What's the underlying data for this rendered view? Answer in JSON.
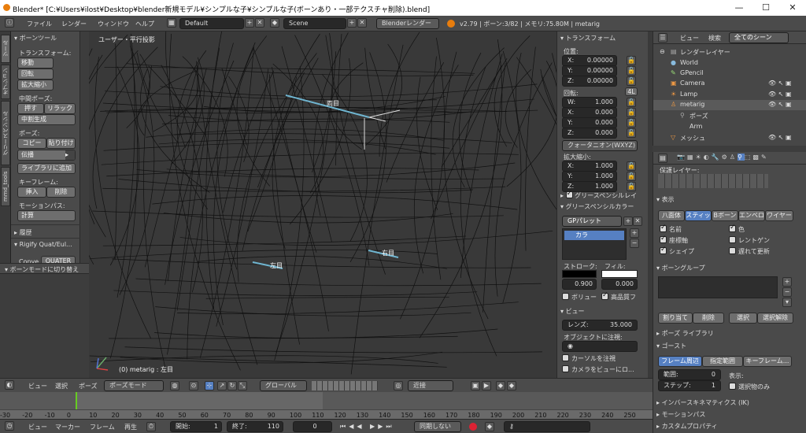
{
  "titlebar": {
    "title": "Blender* [C:¥Users¥ilost¥Desktop¥blender新規モデル¥シンプルな子¥シンプルな子(ボーンあり・一部テクスチャ削除).blend]",
    "min": "—",
    "max": "☐",
    "close": "✕"
  },
  "menu": {
    "file": "ファイル",
    "render": "レンダー",
    "window": "ウィンドウ",
    "help": "ヘルプ",
    "layout": "Default",
    "scene": "Scene",
    "engine": "Blenderレンダー",
    "status": "v2.79 | ボーン:3/82 | メモリ:75.80M | metarig"
  },
  "toolshelf": {
    "panel": "ボーンツール",
    "transform": "トランスフォーム:",
    "move": "移動",
    "rotate": "回転",
    "scale": "拡大縮小",
    "mid_pose": "中間ポーズ:",
    "push": "押す",
    "relax": "リラック",
    "breakdown": "中割生成",
    "pose": "ポーズ:",
    "copy": "コピー",
    "paste": "貼り付け",
    "propagate": "伝播",
    "add_library": "ライブラリに追加",
    "keyframes": "キーフレーム:",
    "insert": "挿入",
    "delete": "削除",
    "motion_paths": "モーションパス:",
    "calculate": "計算",
    "history": "履歴",
    "rigify": "Rigify Quat/Eul...",
    "convert": "Conve",
    "quater": "QUATER",
    "toggle": "ボーンモードに切り替え",
    "tabs": [
      "ツール",
      "オプション",
      "グリースペンシル",
      "mmd_tools"
    ]
  },
  "viewport": {
    "view_label": "ユーザー・平行投影",
    "bone_both": "両目",
    "bone_left": "左目",
    "bone_right": "右目",
    "status": "(0) metarig : 左目"
  },
  "npanel": {
    "transform": "トランスフォーム",
    "location": "位置:",
    "x": "X:",
    "y": "Y:",
    "z": "Z:",
    "w": "W:",
    "loc_x": "0.00000",
    "loc_y": "0.00000",
    "loc_z": "0.00000",
    "rotation": "回転:",
    "mode_4l": "4L",
    "rot_w": "1.000",
    "rot_x": "0.000",
    "rot_y": "0.000",
    "rot_z": "0.000",
    "quat": "クォータニオン(WXYZ)",
    "scale": "拡大縮小:",
    "scl_x": "1.000",
    "scl_y": "1.000",
    "scl_z": "1.000",
    "gp_layer": "グリースペンシルレイ",
    "gp_color": "グリースペンシルカラー",
    "gp_palette": "GPパレット",
    "color": "カラ",
    "stroke": "ストローク:",
    "fill": "フィル:",
    "stroke_val": "0.900",
    "fill_val": "0.000",
    "volume": "ボリュー",
    "hq": "高品質フ",
    "view": "ビュー",
    "lens": "レンズ:",
    "lens_val": "35.000",
    "lock_obj": "オブジェクトに注視:",
    "lock_cursor": "カーソルを注視",
    "lock_camera": "カメラをビューにロ..."
  },
  "outliner": {
    "view": "ビュー",
    "search": "検索",
    "scene_sel": "全てのシーン",
    "items": [
      "レンダーレイヤー",
      "World",
      "GPencil",
      "Camera",
      "Lamp",
      "metarig",
      "ポーズ",
      "Arm",
      "メッシュ"
    ]
  },
  "properties": {
    "protect": "保護レイヤー:",
    "display": "表示",
    "d_tabs": [
      "八面体",
      "スティッ",
      "Bボーン",
      "エンベロ",
      "ワイヤー"
    ],
    "name": "名前",
    "color": "色",
    "axes": "座標軸",
    "xray": "レントゲン",
    "shape": "シェイプ",
    "delay": "遅れて更新",
    "bone_groups": "ボーングループ",
    "assign": "割り当て",
    "remove": "削除",
    "select": "選択",
    "deselect": "選択解除",
    "pose_library": "ポーズ ライブラリ",
    "ghost": "ゴースト",
    "g_tabs": [
      "フレーム周辺",
      "指定範囲",
      "キーフレーム..."
    ],
    "range": "範囲:",
    "range_val": "0",
    "step": "ステップ:",
    "step_val": "1",
    "display2": "表示:",
    "sel_only": "選択物のみ",
    "ik": "インバースキネマティクス (IK)",
    "motion_paths": "モーションパス",
    "custom_props": "カスタムプロパティ"
  },
  "vpheader": {
    "view": "ビュー",
    "select": "選択",
    "pose": "ポーズ",
    "mode": "ポーズモード",
    "orient": "グローバル",
    "snap": "近接"
  },
  "timeline": {
    "ticks": [
      "-30",
      "-20",
      "-10",
      "0",
      "10",
      "20",
      "30",
      "40",
      "50",
      "60",
      "70",
      "80",
      "90",
      "100",
      "110",
      "120",
      "130",
      "140",
      "150",
      "160",
      "170",
      "180",
      "190",
      "200",
      "210",
      "220",
      "230",
      "240",
      "250"
    ],
    "current_frame": "0"
  },
  "tlheader": {
    "view": "ビュー",
    "marker": "マーカー",
    "frame": "フレーム",
    "play": "再生",
    "start": "開始:",
    "start_val": "1",
    "end": "終了:",
    "end_val": "110",
    "cur_val": "0",
    "sync": "同期しない"
  },
  "colors": {
    "accent": "#5680c2",
    "bg": "#3d3d3d",
    "panel": "#4a4a4a",
    "orange": "#e87d0d"
  }
}
